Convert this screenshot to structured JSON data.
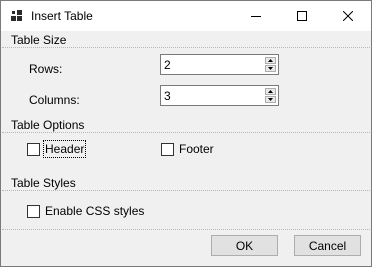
{
  "window": {
    "title": "Insert Table",
    "icons": {
      "app": "table-icon",
      "minimize": "minimize-icon",
      "maximize": "maximize-icon",
      "close": "close-icon"
    }
  },
  "table_size": {
    "heading": "Table Size",
    "rows_label": "Rows:",
    "rows_value": "2",
    "columns_label": "Columns:",
    "columns_value": "3"
  },
  "table_options": {
    "heading": "Table Options",
    "header_label": "Header",
    "header_checked": false,
    "footer_label": "Footer",
    "footer_checked": false
  },
  "table_styles": {
    "heading": "Table Styles",
    "css_label": "Enable CSS styles",
    "css_checked": false
  },
  "buttons": {
    "ok": "OK",
    "cancel": "Cancel"
  }
}
